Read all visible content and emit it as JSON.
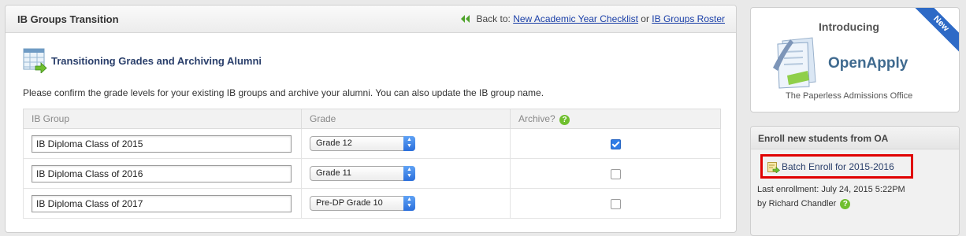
{
  "header": {
    "title": "IB Groups Transition",
    "back_prefix": "Back to:",
    "link_checklist": "New Academic Year Checklist",
    "or": "or",
    "link_roster": "IB Groups Roster"
  },
  "section": {
    "title": "Transitioning Grades and Archiving Alumni",
    "instructions": "Please confirm the grade levels for your existing IB groups and archive your alumni. You can also update the IB group name."
  },
  "table": {
    "headers": {
      "group": "IB Group",
      "grade": "Grade",
      "archive": "Archive?"
    },
    "rows": [
      {
        "name": "IB Diploma Class of 2015",
        "grade": "Grade 12",
        "archived": true
      },
      {
        "name": "IB Diploma Class of 2016",
        "grade": "Grade 11",
        "archived": false
      },
      {
        "name": "IB Diploma Class of 2017",
        "grade": "Pre-DP Grade 10",
        "archived": false
      }
    ]
  },
  "ad": {
    "intro": "Introducing",
    "brand": "OpenApply",
    "tagline": "The Paperless Admissions Office",
    "ribbon": "New"
  },
  "enroll": {
    "title": "Enroll new students from OA",
    "batch_label": "Batch Enroll for 2015-2016",
    "last_enrollment": "Last enrollment: July 24, 2015 5:22PM",
    "by": "by Richard Chandler"
  },
  "icons": {
    "back": "double-chevron-left-icon",
    "section": "spreadsheet-arrow-icon",
    "help": "question-icon",
    "batch": "document-arrow-icon",
    "select": "up-down-arrows-icon"
  },
  "colors": {
    "link": "#1a3fa8",
    "accent_green": "#6fbf2e",
    "highlight_red": "#e00000",
    "ribbon_blue": "#2e6ac6"
  }
}
